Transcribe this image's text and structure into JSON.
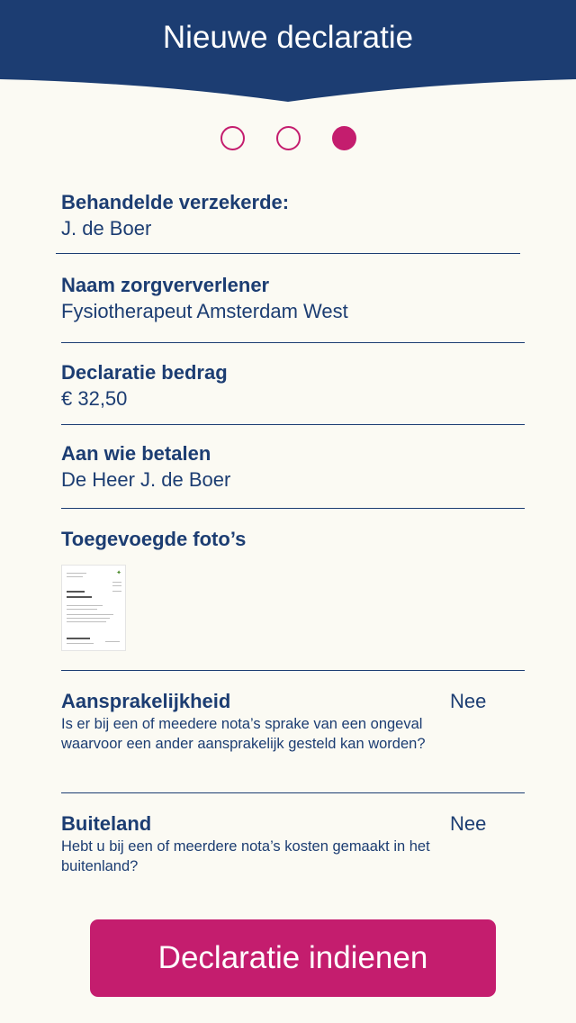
{
  "header": {
    "title": "Nieuwe declaratie"
  },
  "steps": [
    {
      "active": false
    },
    {
      "active": false
    },
    {
      "active": true
    }
  ],
  "insured": {
    "label": "Behandelde verzekerde:",
    "value": "J. de Boer"
  },
  "provider": {
    "label": "Naam zorgververlener",
    "value": "Fysiotherapeut Amsterdam West"
  },
  "amount": {
    "label": "Declaratie bedrag",
    "value": "€ 32,50"
  },
  "payee": {
    "label": "Aan wie betalen",
    "value": "De Heer J. de Boer"
  },
  "photos": {
    "label": "Toegevoegde foto’s",
    "thumb_icon": "receipt-photo"
  },
  "liability": {
    "title": "Aansprakelijkheid",
    "description": "Is er bij een of meedere nota’s sprake van een ongeval waarvoor een ander aansprakelijk gesteld kan worden?",
    "answer": "Nee"
  },
  "abroad": {
    "title": "Buiteland",
    "description": "Hebt u bij een of meerdere nota’s kosten gemaakt in het buitenland?",
    "answer": "Nee"
  },
  "submit": {
    "label": "Declaratie indienen"
  },
  "colors": {
    "primary": "#1c3d72",
    "accent": "#c41d6e",
    "background": "#fbfaf3"
  }
}
